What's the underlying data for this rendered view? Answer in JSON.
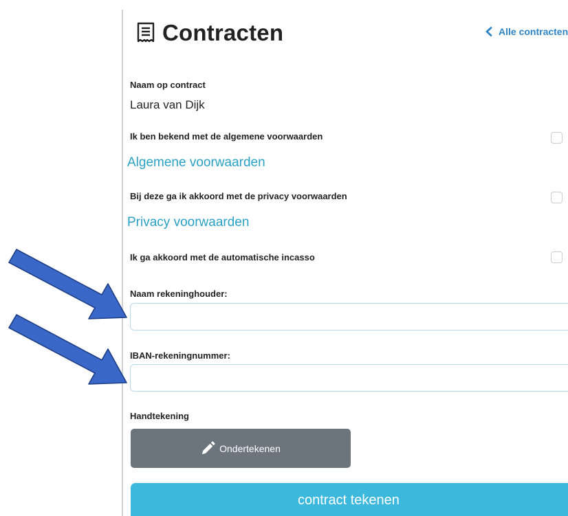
{
  "header": {
    "title": "Contracten",
    "back_link": "Alle contracten"
  },
  "form": {
    "name_label": "Naam op contract",
    "name_value": "Laura van Dijk",
    "terms": {
      "checkbox_label": "Ik ben bekend met de algemene voorwaarden",
      "link": "Algemene voorwaarden",
      "checked": false
    },
    "privacy": {
      "checkbox_label": "Bij deze ga ik akkoord met de privacy voorwaarden",
      "link": "Privacy voorwaarden",
      "checked": false
    },
    "debit": {
      "checkbox_label": "Ik ga akkoord met de automatische incasso",
      "checked": false
    },
    "account_holder": {
      "label": "Naam rekeninghouder:",
      "value": "",
      "placeholder": ""
    },
    "iban": {
      "label": "IBAN-rekeningnummer:",
      "value": "",
      "placeholder": ""
    },
    "signature": {
      "label": "Handtekening",
      "button": "Ondertekenen"
    },
    "submit": "contract tekenen"
  },
  "icons": {
    "header": "receipt-icon",
    "back": "chevron-left-icon",
    "sign": "pencil-icon",
    "annotations": "arrow-icon"
  },
  "colors": {
    "accent_link": "#2aa0c4",
    "back_link": "#2f84c5",
    "sign_button": "#6c757d",
    "submit_button": "#3db8dd",
    "annotation_arrow": "#3a68c9"
  }
}
